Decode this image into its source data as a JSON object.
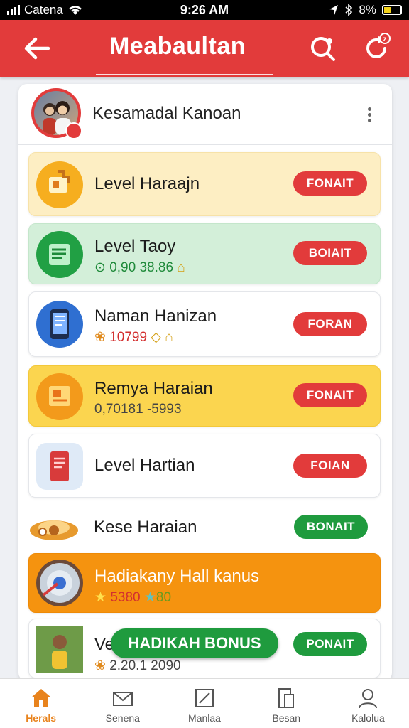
{
  "status_bar": {
    "carrier": "Catena",
    "time": "9:26 AM",
    "battery": "8%"
  },
  "header": {
    "title": "Meabaultan",
    "notification_count": "z"
  },
  "profile": {
    "name": "Kesamadal Kanoan"
  },
  "rewards": [
    {
      "title": "Level Haraajn",
      "subtitle": "",
      "button": "FONAIT"
    },
    {
      "title": "Level Taoy",
      "subtitle": "0,90 38.86",
      "button": "BOIAIT"
    },
    {
      "title": "Naman Hanizan",
      "subtitle": "10799",
      "button": "FORAN"
    },
    {
      "title": "Remya Haraian",
      "subtitle": "0,70181 -5993",
      "button": "FONAIT"
    },
    {
      "title": "Level Hartian",
      "subtitle": "",
      "button": "FOIAN"
    },
    {
      "title": "Kese Haraian",
      "subtitle": "",
      "button": "BONAIT"
    },
    {
      "title": "Hadiakany Hall kanus",
      "subtitle_red": "5380",
      "subtitle_green": "80",
      "button": ""
    },
    {
      "title": "Ve",
      "subtitle": "2.20.1 2090",
      "button": "PONAIT"
    }
  ],
  "floating_button": "HADIKAH BONUS",
  "bottom_nav": [
    {
      "label": "Herals",
      "icon": "home-icon",
      "active": true
    },
    {
      "label": "Senena",
      "icon": "mail-icon"
    },
    {
      "label": "Manlaa",
      "icon": "edit-icon"
    },
    {
      "label": "Besan",
      "icon": "document-icon"
    },
    {
      "label": "Kalolua",
      "icon": "profile-icon"
    }
  ]
}
